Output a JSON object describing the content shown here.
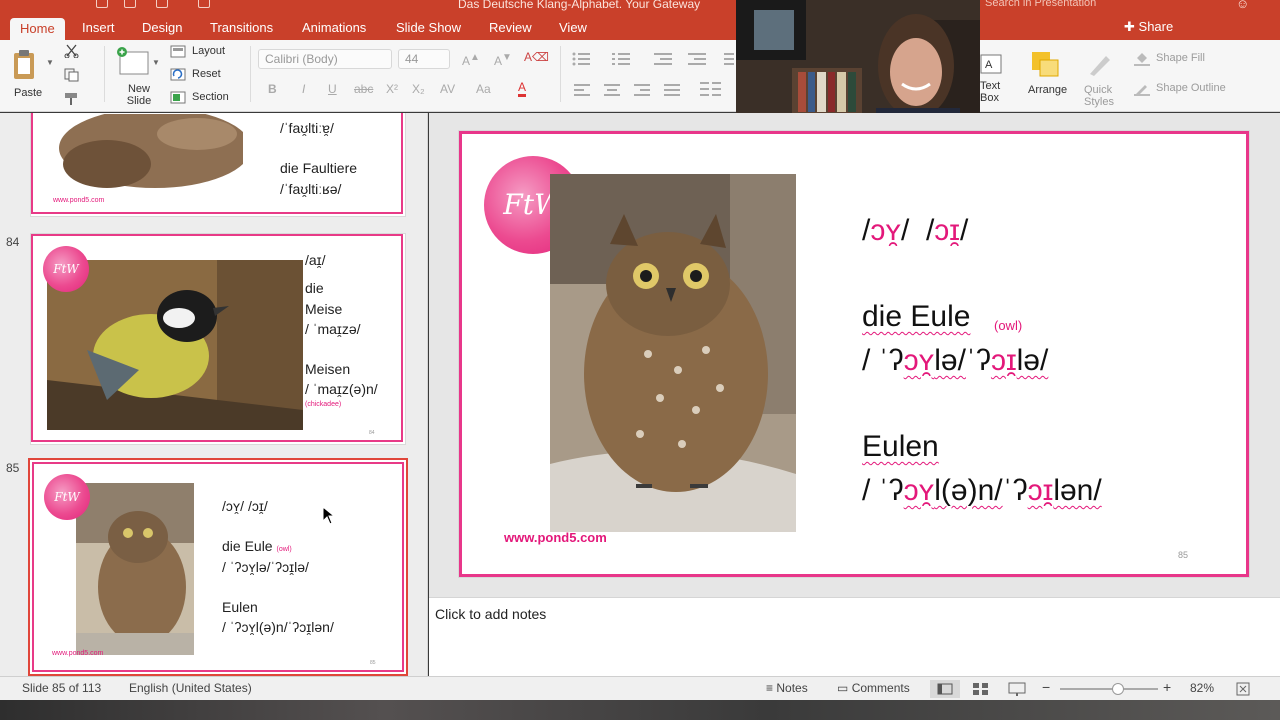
{
  "window": {
    "title": "Das Deutsche Klang-Alphabet. Your Gateway",
    "search_placeholder": "Search in Presentation"
  },
  "tabs": [
    {
      "label": "Home",
      "active": true
    },
    {
      "label": "Insert"
    },
    {
      "label": "Design"
    },
    {
      "label": "Transitions"
    },
    {
      "label": "Animations"
    },
    {
      "label": "Slide Show"
    },
    {
      "label": "Review"
    },
    {
      "label": "View"
    }
  ],
  "share_label": "Share",
  "ribbon": {
    "paste": "Paste",
    "new_slide": "New Slide",
    "layout": "Layout",
    "reset": "Reset",
    "section": "Section",
    "font_name": "Calibri (Body)",
    "font_size": "44",
    "text_box": "Text Box",
    "arrange": "Arrange",
    "quick_styles": "Quick Styles",
    "shape_fill": "Shape Fill",
    "shape_outline": "Shape Outline"
  },
  "thumbnails": [
    {
      "number": "",
      "lines": [
        "/ˈfaʊ̯ltiːɐ̯/",
        "",
        "die Faultiere",
        "/ˈfaʊ̯ltiːʁə/"
      ],
      "url": "www.pond5.com"
    },
    {
      "number": "84",
      "lines": [
        "/aɪ̯/",
        "",
        "die",
        "Meise",
        "/ ˈmaɪ̯zə/",
        "",
        "Meisen",
        "/ ˈmaɪ̯z(ə)n/"
      ],
      "note": "(chickadee)"
    },
    {
      "number": "85",
      "lines": [
        "/ɔʏ̯/  /ɔɪ̯/",
        "",
        "die Eule",
        "/ ˈʔɔʏ̯lə/ˈʔɔɪ̯lə/",
        "",
        "Eulen",
        "/ ˈʔɔʏ̯l(ə)n/ˈʔɔɪ̯lən/"
      ],
      "note": "(owl)",
      "url": "www.pond5.com",
      "selected": true
    }
  ],
  "slide": {
    "sound_a": "ɔʏ̯",
    "sound_b": "ɔɪ̯",
    "word_singular": "die Eule",
    "owl_note": "(owl)",
    "ipa_sg_a": "ɔʏ̯",
    "ipa_sg_a_rest": "lə/",
    "ipa_sg_b": "ɔɪ̯",
    "ipa_sg_b_rest": "lə/",
    "word_plural": "Eulen",
    "ipa_pl_a": "ɔʏ̯",
    "ipa_pl_a_rest": "l(ə)n/",
    "ipa_pl_b": "ɔɪ̯",
    "ipa_pl_b_rest": "lən/",
    "url": "www.pond5.com",
    "page_number": "85",
    "accent_color": "#e3187a"
  },
  "notes_placeholder": "Click to add notes",
  "status": {
    "slide_counter": "Slide 85 of 113",
    "language": "English (United States)",
    "notes": "Notes",
    "comments": "Comments",
    "zoom": "82%",
    "zoom_level": 0.6
  }
}
